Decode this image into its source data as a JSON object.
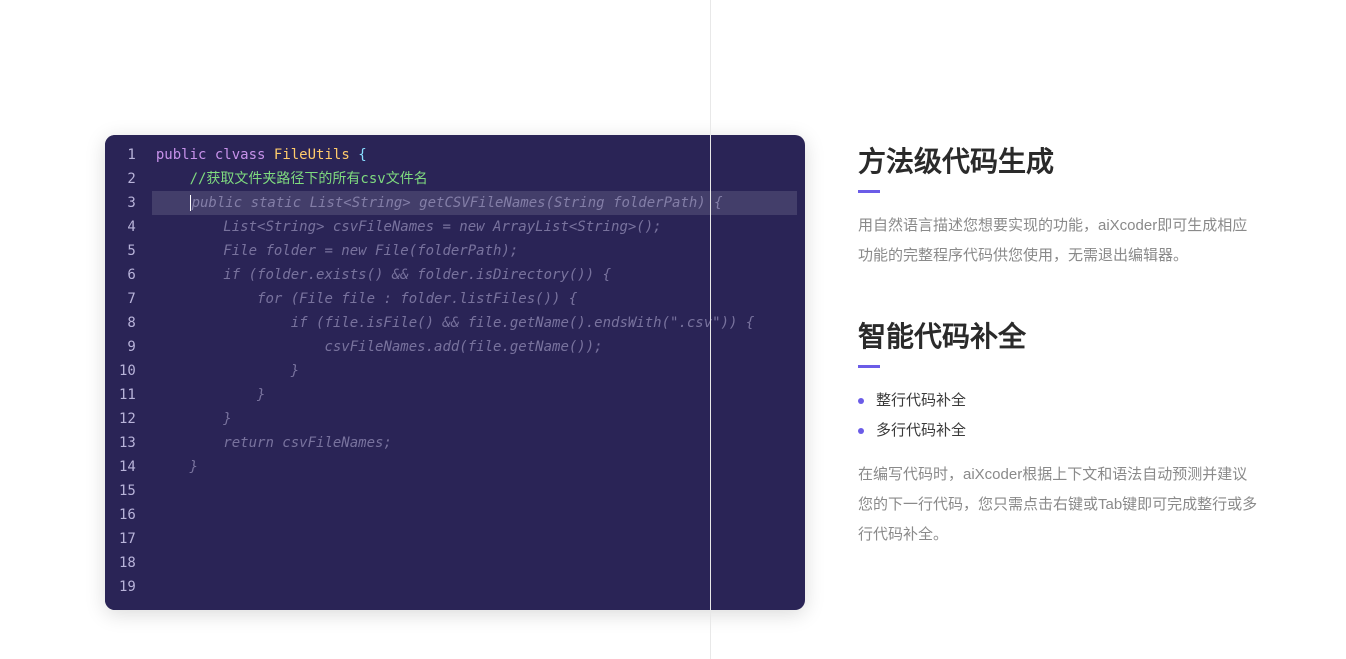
{
  "editor": {
    "lineCount": 19,
    "lines": [
      {
        "tokens": [
          {
            "t": "public",
            "c": "kw"
          },
          {
            "t": " "
          },
          {
            "t": "clvass",
            "c": "kw"
          },
          {
            "t": " "
          },
          {
            "t": "FileUtils",
            "c": "cls"
          },
          {
            "t": " "
          },
          {
            "t": "{",
            "c": "punc"
          }
        ]
      },
      {
        "indent": 1,
        "tokens": [
          {
            "t": "//获取文件夹路径下的所有csv文件名",
            "c": "cmt"
          }
        ]
      },
      {
        "hl": true,
        "indent": 1,
        "cursor": true,
        "tokens": [
          {
            "t": "public static List<String> getCSVFileNames(String folderPath) {",
            "c": "sug"
          }
        ]
      },
      {
        "indent": 2,
        "tokens": [
          {
            "t": "List<String> csvFileNames = new ArrayList<String>();",
            "c": "sug"
          }
        ]
      },
      {
        "indent": 2,
        "tokens": [
          {
            "t": "File folder = new File(folderPath);",
            "c": "sug"
          }
        ]
      },
      {
        "indent": 2,
        "tokens": [
          {
            "t": "if (folder.exists() && folder.isDirectory()) {",
            "c": "sug"
          }
        ]
      },
      {
        "indent": 3,
        "tokens": [
          {
            "t": "for (File file : folder.listFiles()) {",
            "c": "sug"
          }
        ]
      },
      {
        "indent": 4,
        "tokens": [
          {
            "t": "if (file.isFile() && file.getName().endsWith(\".csv\")) {",
            "c": "sug"
          }
        ]
      },
      {
        "indent": 5,
        "tokens": [
          {
            "t": "csvFileNames.add(file.getName());",
            "c": "sug"
          }
        ]
      },
      {
        "indent": 4,
        "tokens": [
          {
            "t": "}",
            "c": "sug"
          }
        ]
      },
      {
        "indent": 3,
        "tokens": [
          {
            "t": "}",
            "c": "sug"
          }
        ]
      },
      {
        "indent": 2,
        "tokens": [
          {
            "t": "}",
            "c": "sug"
          }
        ]
      },
      {
        "indent": 2,
        "tokens": [
          {
            "t": "return csvFileNames;",
            "c": "sug"
          }
        ]
      },
      {
        "indent": 1,
        "tokens": [
          {
            "t": "}",
            "c": "sug"
          }
        ]
      },
      {
        "tokens": []
      },
      {
        "tokens": []
      },
      {
        "tokens": []
      },
      {
        "tokens": []
      },
      {
        "tokens": []
      }
    ]
  },
  "sections": [
    {
      "title": "方法级代码生成",
      "desc": "用自然语言描述您想要实现的功能，aiXcoder即可生成相应功能的完整程序代码供您使用，无需退出编辑器。"
    },
    {
      "title": "智能代码补全",
      "bullets": [
        "整行代码补全",
        "多行代码补全"
      ],
      "desc": "在编写代码时，aiXcoder根据上下文和语法自动预测并建议您的下一行代码，您只需点击右键或Tab键即可完成整行或多行代码补全。"
    }
  ]
}
